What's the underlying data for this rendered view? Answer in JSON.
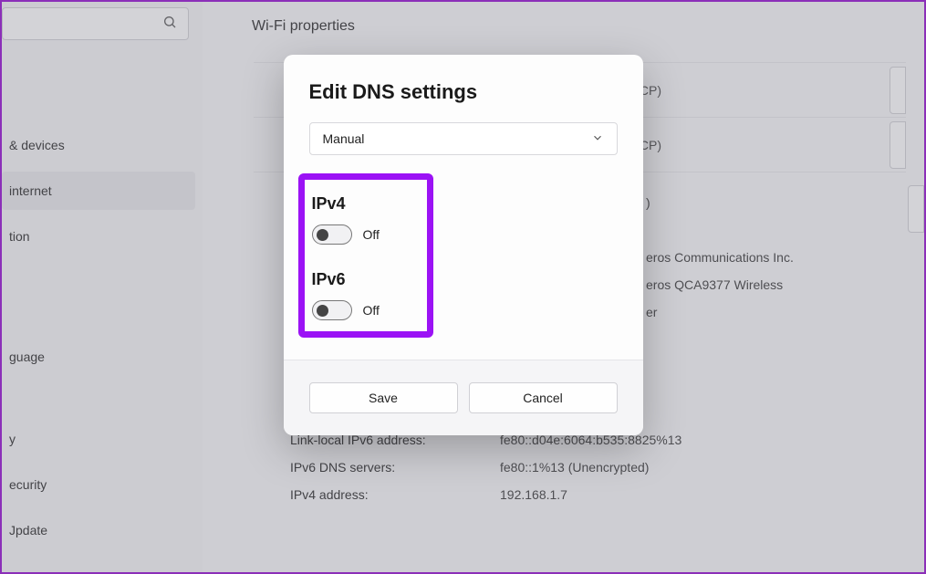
{
  "sidebar": {
    "search_placeholder": "",
    "items": [
      {
        "label": "& devices"
      },
      {
        "label": "internet"
      },
      {
        "label": "tion"
      },
      {
        "label": "guage"
      },
      {
        "label": "y"
      },
      {
        "label": "ecurity"
      },
      {
        "label": "Jpdate"
      }
    ]
  },
  "page": {
    "title": "Wi-Fi properties"
  },
  "rows": [
    {
      "label": "",
      "value": "CP)"
    },
    {
      "label": "",
      "value": "CP)"
    }
  ],
  "block_values": [
    ")",
    "eros Communications Inc.",
    "eros QCA9377 Wireless",
    "er"
  ],
  "info": [
    {
      "k": "Link-local IPv6 address:",
      "v": "fe80::d04e:6064:b535:8825%13"
    },
    {
      "k": "IPv6 DNS servers:",
      "v": "fe80::1%13 (Unencrypted)"
    },
    {
      "k": "IPv4 address:",
      "v": "192.168.1.7"
    }
  ],
  "dialog": {
    "title": "Edit DNS settings",
    "mode": "Manual",
    "ipv4_label": "IPv4",
    "ipv4_state": "Off",
    "ipv6_label": "IPv6",
    "ipv6_state": "Off",
    "save": "Save",
    "cancel": "Cancel"
  }
}
